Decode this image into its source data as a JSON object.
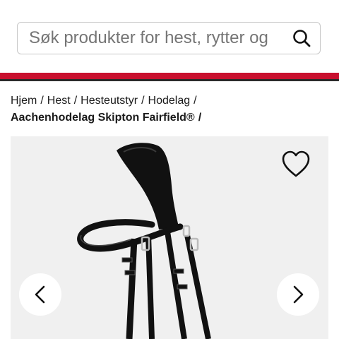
{
  "search": {
    "placeholder": "Søk produkter for hest, rytter og hund",
    "icon": "search-icon"
  },
  "header": {
    "accent_color": "#c8102e",
    "line_color": "#2a2a2a"
  },
  "breadcrumb": {
    "items": [
      "Hjem",
      "Hest",
      "Hesteutstyr",
      "Hodelag"
    ],
    "separator": "/",
    "current": "Aachenhodelag Skipton Fairfield®"
  },
  "product": {
    "image_alt": "Aachenhodelag Skipton Fairfield®",
    "favorite_icon": "heart-icon",
    "prev_icon": "chevron-left-icon",
    "next_icon": "chevron-right-icon"
  }
}
